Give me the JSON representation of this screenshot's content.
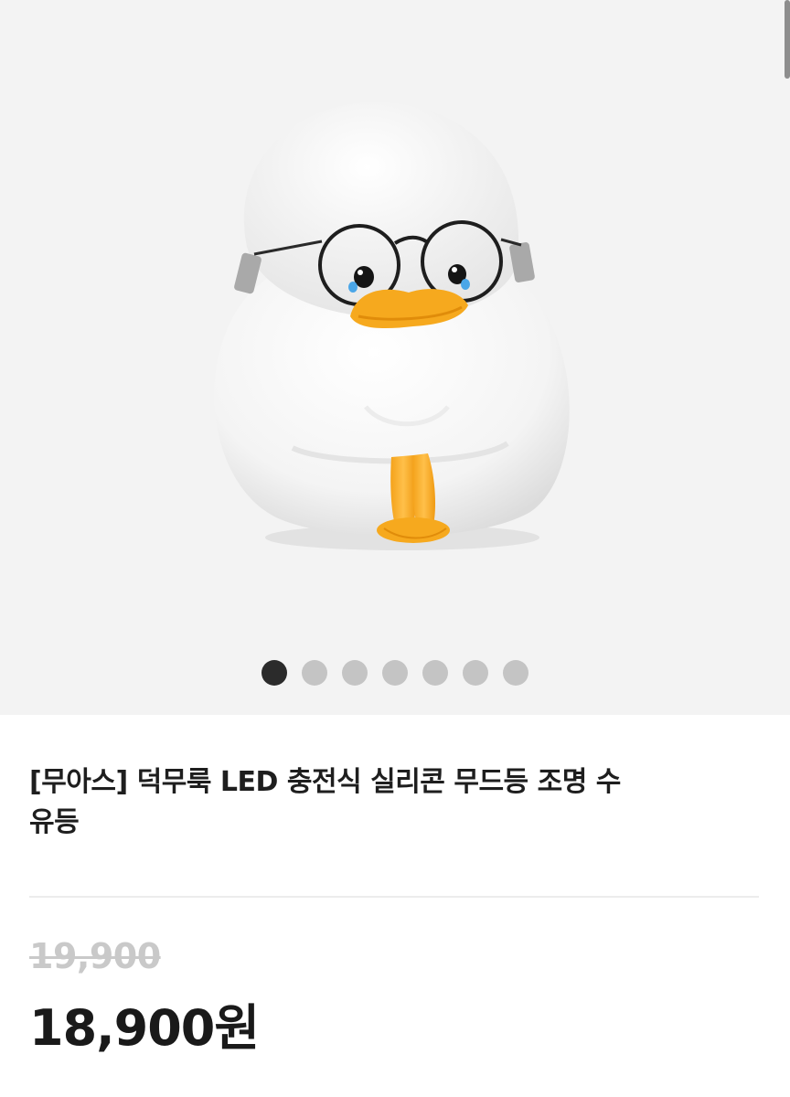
{
  "gallery": {
    "image_alt": "white duck silicone mood lamp with round glasses",
    "slide_count": 7,
    "active_slide": 1,
    "background_color": "#f3f3f3"
  },
  "product": {
    "title_line1": "[무아스] 덕무룩 LED 충전식 실리콘 무드등 조명 수",
    "title_line2": "유등",
    "original_price": "19,900",
    "sale_price": "18,900원"
  },
  "colors": {
    "active_dot": "#2b2b2b",
    "inactive_dot": "#c4c4c4",
    "beak": "#f6a91e",
    "old_price": "#c9c9c9"
  }
}
